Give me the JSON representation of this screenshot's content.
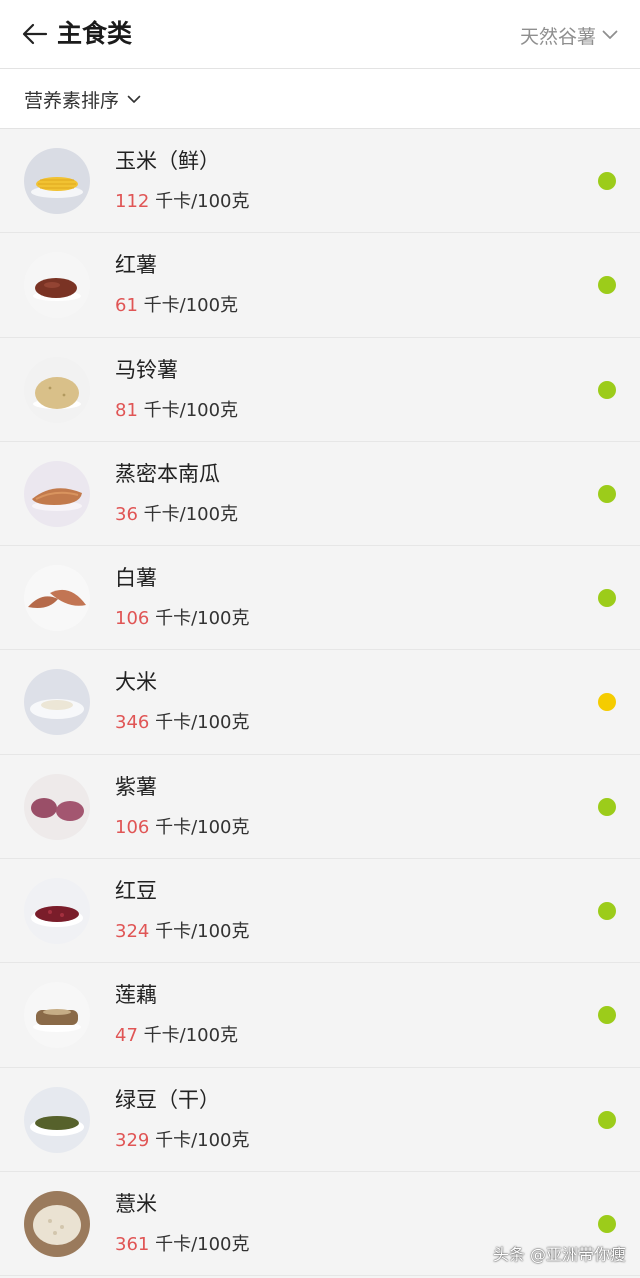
{
  "header": {
    "title": "主食类",
    "category": "天然谷薯",
    "back_icon": "arrow-left-icon",
    "dropdown_icon": "chevron-down-icon"
  },
  "sortbar": {
    "label": "营养素排序",
    "dropdown_icon": "chevron-down-icon"
  },
  "colors": {
    "green_dot": "#9ccc1a",
    "yellow_dot": "#f5cc00",
    "kcal_red": "#e05555"
  },
  "items": [
    {
      "name": "玉米（鲜）",
      "kcal": "112",
      "unit": " 千卡/100克",
      "status": "green",
      "icon": "corn-icon"
    },
    {
      "name": "红薯",
      "kcal": "61",
      "unit": " 千卡/100克",
      "status": "green",
      "icon": "red-sweet-potato-icon"
    },
    {
      "name": "马铃薯",
      "kcal": "81",
      "unit": " 千卡/100克",
      "status": "green",
      "icon": "potato-icon"
    },
    {
      "name": "蒸密本南瓜",
      "kcal": "36",
      "unit": " 千卡/100克",
      "status": "green",
      "icon": "pumpkin-icon"
    },
    {
      "name": "白薯",
      "kcal": "106",
      "unit": " 千卡/100克",
      "status": "green",
      "icon": "white-sweet-potato-icon"
    },
    {
      "name": "大米",
      "kcal": "346",
      "unit": " 千卡/100克",
      "status": "yellow",
      "icon": "rice-icon"
    },
    {
      "name": "紫薯",
      "kcal": "106",
      "unit": " 千卡/100克",
      "status": "green",
      "icon": "purple-sweet-potato-icon"
    },
    {
      "name": "红豆",
      "kcal": "324",
      "unit": " 千卡/100克",
      "status": "green",
      "icon": "red-bean-icon"
    },
    {
      "name": "莲藕",
      "kcal": "47",
      "unit": " 千卡/100克",
      "status": "green",
      "icon": "lotus-root-icon"
    },
    {
      "name": "绿豆（干）",
      "kcal": "329",
      "unit": " 千卡/100克",
      "status": "green",
      "icon": "mung-bean-icon"
    },
    {
      "name": "薏米",
      "kcal": "361",
      "unit": " 千卡/100克",
      "status": "green",
      "icon": "coix-seed-icon"
    }
  ],
  "watermark": "头条 @亚洲带你瘦"
}
